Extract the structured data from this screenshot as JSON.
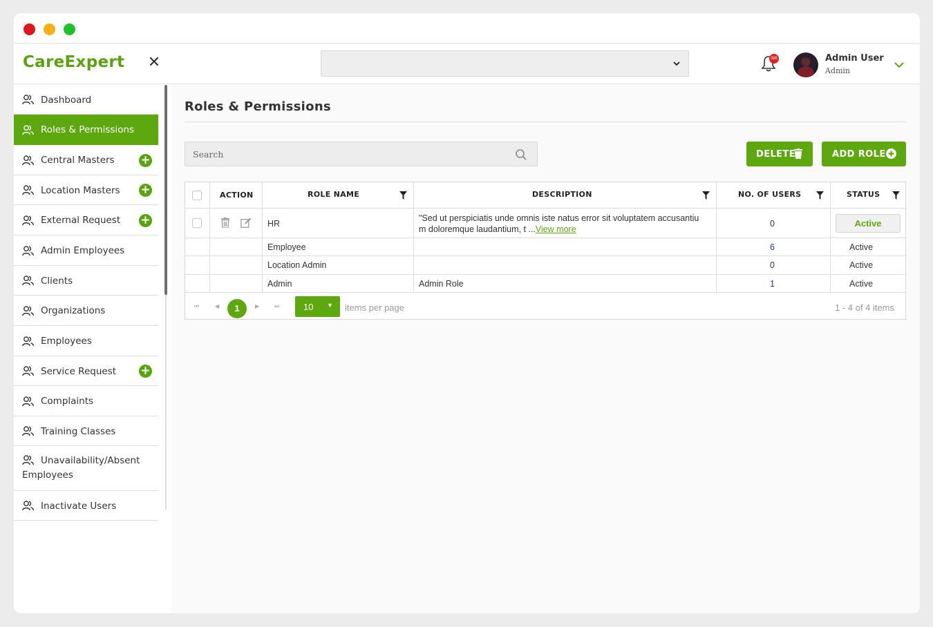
{
  "app": {
    "logo": "CareExpert"
  },
  "header": {
    "select_value": "",
    "notification_count": "385",
    "user_name": "Admin User",
    "user_role": "Admin"
  },
  "sidebar": {
    "items": [
      {
        "label": "Dashboard",
        "has_add": false,
        "active": false
      },
      {
        "label": "Roles & Permissions",
        "has_add": false,
        "active": true
      },
      {
        "label": "Central Masters",
        "has_add": true,
        "active": false
      },
      {
        "label": "Location Masters",
        "has_add": true,
        "active": false
      },
      {
        "label": "External Request",
        "has_add": true,
        "active": false
      },
      {
        "label": "Admin Employees",
        "has_add": false,
        "active": false
      },
      {
        "label": "Clients",
        "has_add": false,
        "active": false
      },
      {
        "label": "Organizations",
        "has_add": false,
        "active": false
      },
      {
        "label": "Employees",
        "has_add": false,
        "active": false
      },
      {
        "label": "Service Request",
        "has_add": true,
        "active": false
      },
      {
        "label": "Complaints",
        "has_add": false,
        "active": false
      },
      {
        "label": "Training Classes",
        "has_add": false,
        "active": false
      },
      {
        "label": "Unavailability/Absent Employees",
        "has_add": false,
        "active": false
      },
      {
        "label": "Inactivate Users",
        "has_add": false,
        "active": false
      }
    ]
  },
  "main": {
    "title": "Roles & Permissions",
    "search_placeholder": "Search",
    "delete_label": "DELETE",
    "add_label": "ADD ROLE",
    "columns": {
      "action": "ACTION",
      "role_name": "ROLE NAME",
      "description": "DESCRIPTION",
      "users": "NO. OF USERS",
      "status": "STATUS"
    },
    "rows": [
      {
        "role_name": "HR",
        "description": "\"Sed ut perspiciatis unde omnis iste natus error sit voluptatem accusantiu",
        "description_line2": "m doloremque laudantium, t ...",
        "view_more": "View more",
        "users": "0",
        "status": "Active"
      },
      {
        "role_name": "Employee",
        "description": "",
        "users": "6",
        "status": "Active"
      },
      {
        "role_name": "Location Admin",
        "description": "",
        "users": "0",
        "status": "Active"
      },
      {
        "role_name": "Admin",
        "description": "Admin Role",
        "users": "1",
        "status": "Active"
      }
    ],
    "pager": {
      "current_page": "1",
      "page_size": "10",
      "page_size_label": "items per page",
      "info": "1 - 4 of 4 items"
    }
  },
  "colors": {
    "accent": "#5ea80f",
    "link": "#1a35c9",
    "badge": "#e11d1d"
  }
}
